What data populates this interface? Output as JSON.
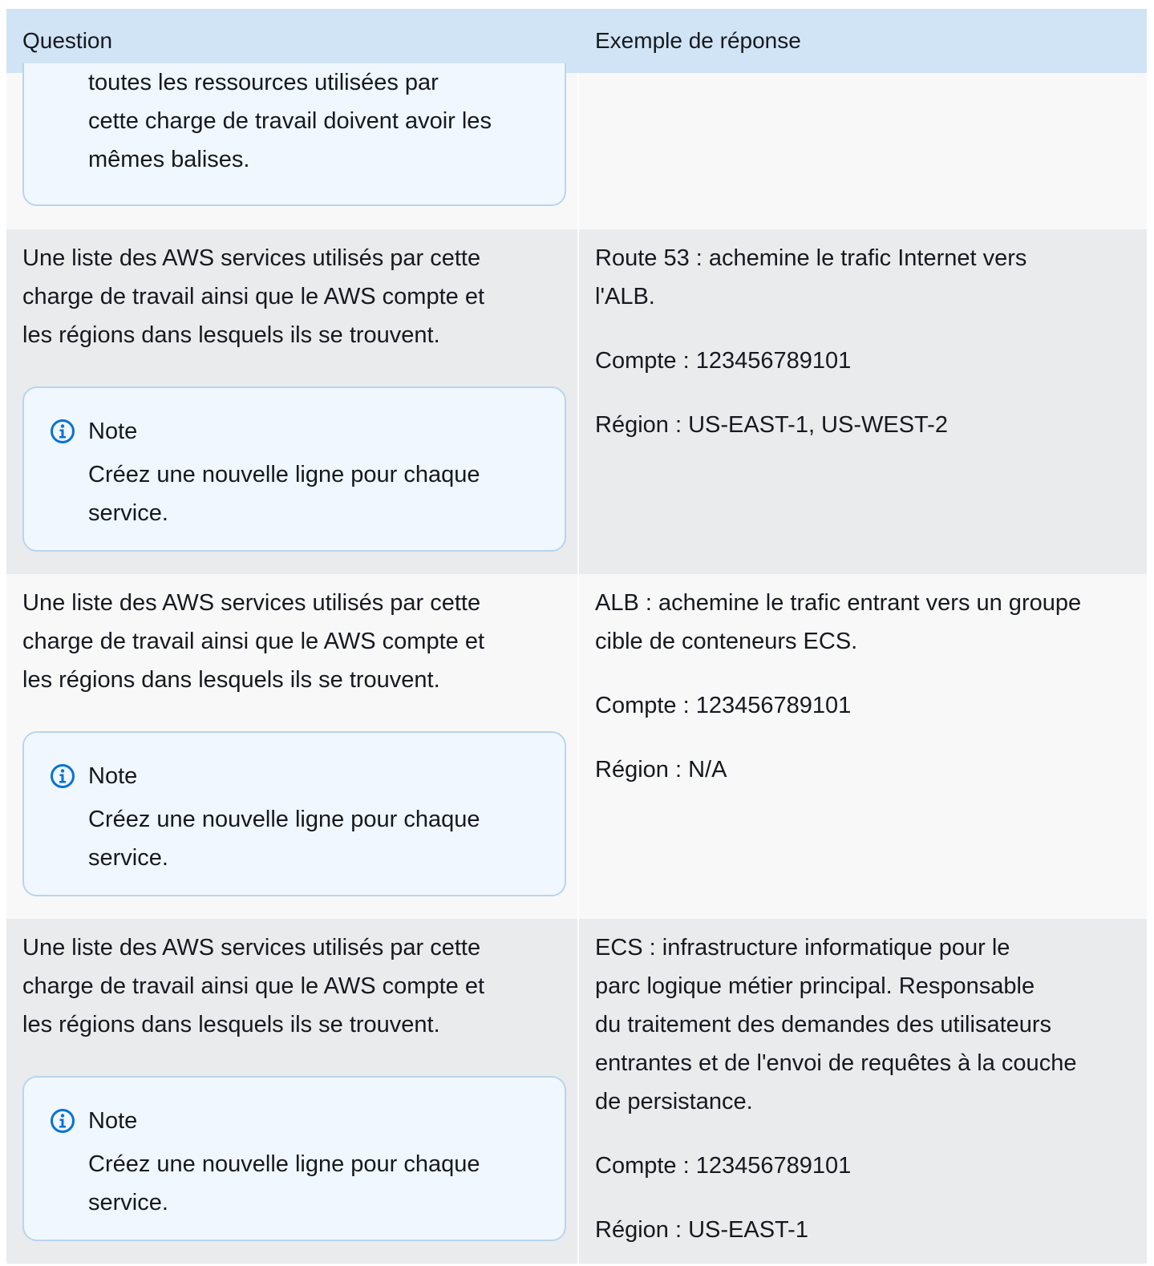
{
  "header": {
    "question": "Question",
    "answer": "Exemple de réponse"
  },
  "first_row": {
    "note_lines": [
      "toutes les ressources utilisées par",
      "cette charge de travail doivent avoir les",
      "mêmes balises."
    ]
  },
  "rows": [
    {
      "question_lines": [
        "Une liste des AWS services utilisés par cette",
        "charge de travail ainsi que le AWS compte et",
        "les régions dans lesquels ils se trouvent."
      ],
      "note_title": "Note",
      "note_lines": [
        "Créez une nouvelle ligne pour chaque",
        "service."
      ],
      "answer_desc_lines": [
        "Route 53 : achemine le trafic Internet vers",
        "l'ALB."
      ],
      "account": "Compte : 123456789101",
      "region": "Région : US-EAST-1, US-WEST-2"
    },
    {
      "question_lines": [
        "Une liste des AWS services utilisés par cette",
        "charge de travail ainsi que le AWS compte et",
        "les régions dans lesquels ils se trouvent."
      ],
      "note_title": "Note",
      "note_lines": [
        "Créez une nouvelle ligne pour chaque",
        "service."
      ],
      "answer_desc_lines": [
        "ALB : achemine le trafic entrant vers un groupe",
        "cible de conteneurs ECS."
      ],
      "account": "Compte : 123456789101",
      "region": "Région : N/A"
    },
    {
      "question_lines": [
        "Une liste des AWS services utilisés par cette",
        "charge de travail ainsi que le AWS compte et",
        "les régions dans lesquels ils se trouvent."
      ],
      "note_title": "Note",
      "note_lines": [
        "Créez une nouvelle ligne pour chaque",
        "service."
      ],
      "answer_desc_lines": [
        "ECS : infrastructure informatique pour le",
        "parc logique métier principal. Responsable",
        "du traitement des demandes des utilisateurs",
        "entrantes et de l'envoi de requêtes à la couche",
        "de persistance."
      ],
      "account": "Compte : 123456789101",
      "region": "Région : US-EAST-1"
    }
  ],
  "colors": {
    "header_bg": "#d1e4f5",
    "row_light": "#f8f8f8",
    "row_gray": "#eaebed",
    "note_bg": "#f0f7fe",
    "note_border": "#b8d5ee",
    "icon_blue": "#0972d3"
  },
  "icons": {
    "note": "info-circle-icon"
  }
}
